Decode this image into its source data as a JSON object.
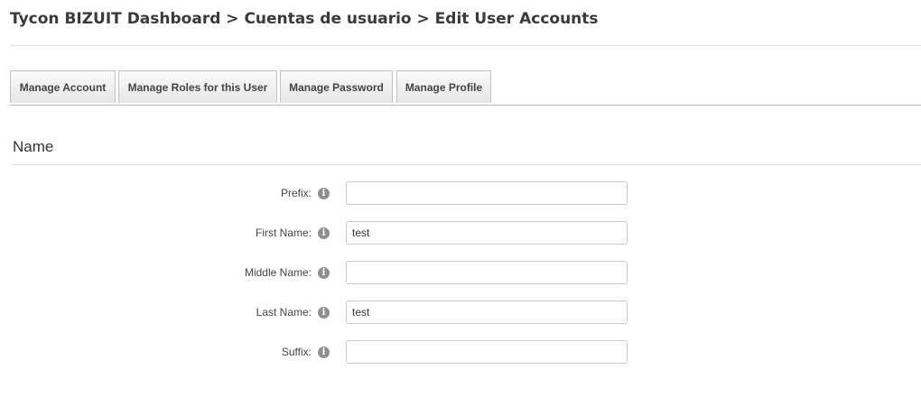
{
  "header": {
    "breadcrumb": "Tycon BIZUIT Dashboard > Cuentas de usuario > Edit User Accounts"
  },
  "tabs": [
    {
      "label": "Manage Account"
    },
    {
      "label": "Manage Roles for this User"
    },
    {
      "label": "Manage Password"
    },
    {
      "label": "Manage Profile"
    }
  ],
  "section": {
    "title": "Name"
  },
  "fields": {
    "prefix": {
      "label": "Prefix:",
      "value": ""
    },
    "first_name": {
      "label": "First Name:",
      "value": "test"
    },
    "middle_name": {
      "label": "Middle Name:",
      "value": ""
    },
    "last_name": {
      "label": "Last Name:",
      "value": "test"
    },
    "suffix": {
      "label": "Suffix:",
      "value": ""
    }
  },
  "icons": {
    "info": "info-icon"
  },
  "colors": {
    "tab_border": "#c2c2c2",
    "info_icon": "#8f8f8f"
  }
}
